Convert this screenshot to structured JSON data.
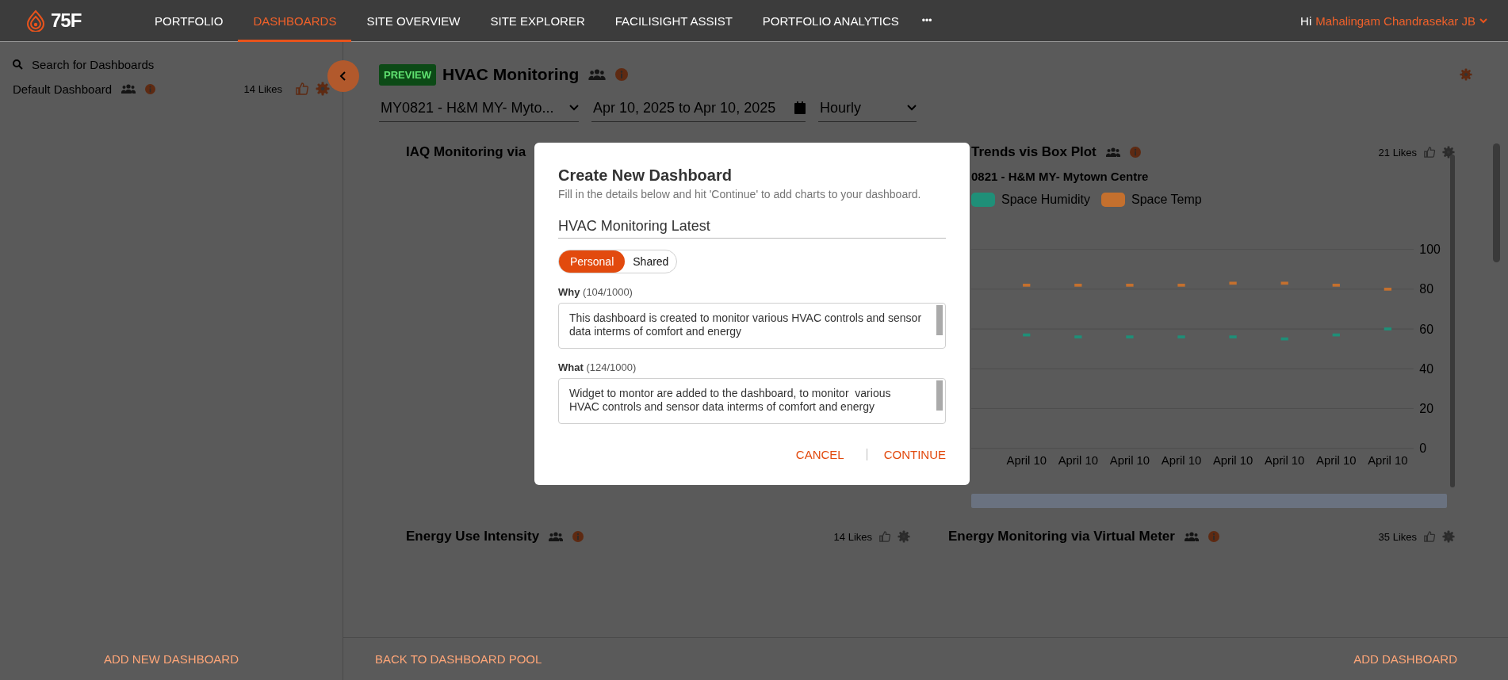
{
  "header": {
    "logo": "75F",
    "nav": [
      {
        "label": "PORTFOLIO",
        "selected": false
      },
      {
        "label": "DASHBOARDS",
        "selected": true
      },
      {
        "label": "SITE OVERVIEW",
        "selected": false
      },
      {
        "label": "SITE EXPLORER",
        "selected": false
      },
      {
        "label": "FACILISIGHT ASSIST",
        "selected": false
      },
      {
        "label": "PORTFOLIO ANALYTICS",
        "selected": false
      }
    ],
    "more": "•••",
    "greeting": "Hi",
    "user": "Mahalingam Chandrasekar JB"
  },
  "sidebar": {
    "search": {
      "placeholder": "Search for Dashboards"
    },
    "items": [
      {
        "name": "Default Dashboard",
        "likes": "14 Likes"
      }
    ],
    "footer_action": "ADD NEW DASHBOARD"
  },
  "dashboard": {
    "badge": "PREVIEW",
    "title": "HVAC Monitoring",
    "site": "MY0821 - H&M MY- Myto...",
    "date_range": "Apr 10, 2025 to Apr 10, 2025",
    "interval": "Hourly"
  },
  "widgets": [
    {
      "kind": "plain",
      "title": "IAQ Monitoring via"
    },
    {
      "kind": "chart",
      "title": "Trends vis Box Plot",
      "likes": "21 Likes",
      "subtitle": "0821 - H&M MY- Mytown Centre",
      "chart_data": {
        "type": "scatter",
        "categories": [
          "April 10",
          "April 10",
          "April 10",
          "April 10",
          "April 10",
          "April 10",
          "April 10",
          "April 10"
        ],
        "ylim": [
          0,
          100
        ],
        "yticks": [
          0,
          20,
          40,
          60,
          80,
          100
        ],
        "grid": true,
        "series": [
          {
            "name": "Space Humidity",
            "color": "#1f8f78",
            "values": [
              57,
              56,
              56,
              56,
              56,
              55,
              57,
              60
            ]
          },
          {
            "name": "Space Temp",
            "color": "#c4702e",
            "values": [
              82,
              82,
              82,
              82,
              83,
              83,
              82,
              80
            ]
          }
        ]
      }
    },
    {
      "kind": "plain",
      "title": "Energy Use Intensity",
      "likes": "14 Likes"
    },
    {
      "kind": "plain",
      "title": "Energy Monitoring via Virtual Meter",
      "likes": "35 Likes"
    }
  ],
  "footer": {
    "back": "BACK TO DASHBOARD POOL",
    "add": "ADD DASHBOARD"
  },
  "dialog": {
    "title": "Create New Dashboard",
    "subtitle": "Fill in the details below and hit 'Continue' to add charts to your dashboard.",
    "name": "HVAC Monitoring Latest",
    "visibility": [
      {
        "label": "Personal",
        "selected": true
      },
      {
        "label": "Shared",
        "selected": false
      }
    ],
    "fields": [
      {
        "label": "Why",
        "count": "(104/1000)",
        "value": "This dashboard is created to monitor various HVAC controls and sensor data interms of comfort and energy"
      },
      {
        "label": "What",
        "count": "(124/1000)",
        "value": "Widget to montor are added to the dashboard, to monitor  various HVAC controls and sensor data interms of comfort and energy"
      }
    ],
    "cancel": "CANCEL",
    "continue": "CONTINUE"
  }
}
